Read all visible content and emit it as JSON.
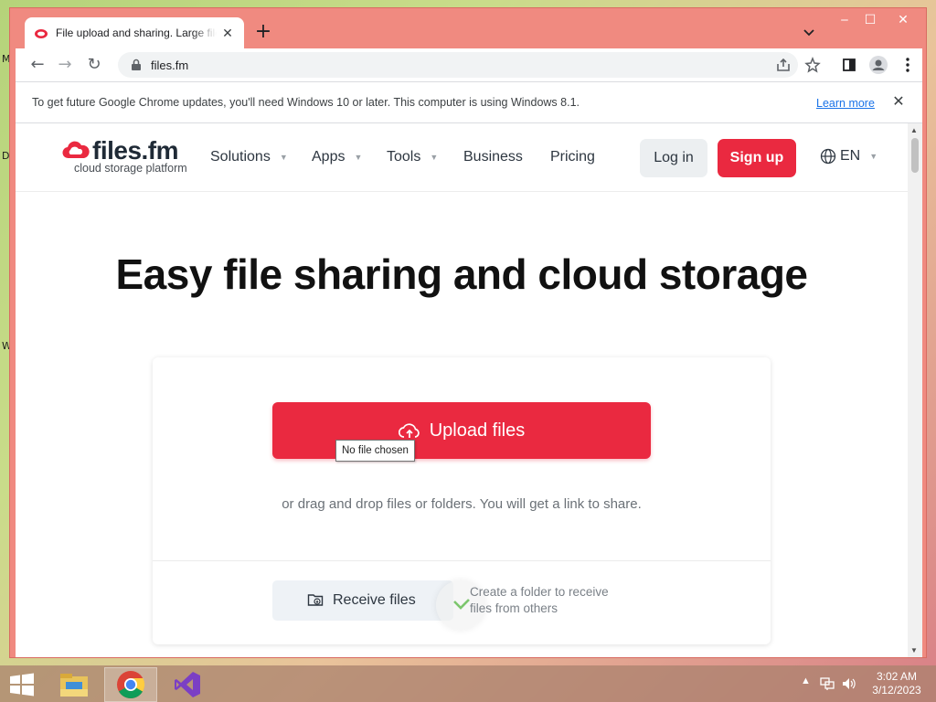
{
  "desktop": {
    "letters": [
      "M",
      "D",
      "W"
    ]
  },
  "browser": {
    "tab_title": "File upload and sharing. Large files",
    "new_tab_symbol": "+",
    "window_controls": {
      "minimize": "‒",
      "maximize": "☐",
      "close": "✕"
    },
    "url": "files.fm",
    "infobar": {
      "message": "To get future Google Chrome updates, you'll need Windows 10 or later. This computer is using Windows 8.1.",
      "link": "Learn more"
    }
  },
  "site": {
    "logo": {
      "name": "files.fm",
      "tagline": "cloud storage platform"
    },
    "nav": [
      {
        "label": "Solutions",
        "has_dropdown": true
      },
      {
        "label": "Apps",
        "has_dropdown": true
      },
      {
        "label": "Tools",
        "has_dropdown": true
      },
      {
        "label": "Business",
        "has_dropdown": false
      },
      {
        "label": "Pricing",
        "has_dropdown": false
      }
    ],
    "login_label": "Log in",
    "signup_label": "Sign up",
    "language": "EN",
    "hero_title": "Easy file sharing and cloud storage",
    "upload_label": "Upload files",
    "tooltip": "No file chosen",
    "drag_text": "or drag and drop files or folders. You will get a link to share.",
    "receive_label": "Receive files",
    "receive_desc_line1": "Create a folder to receive",
    "receive_desc_line2": "files from others"
  },
  "colors": {
    "brand_red": "#ea2940",
    "chrome_frame": "#f08a80"
  },
  "taskbar": {
    "time": "3:02 AM",
    "date": "3/12/2023"
  }
}
